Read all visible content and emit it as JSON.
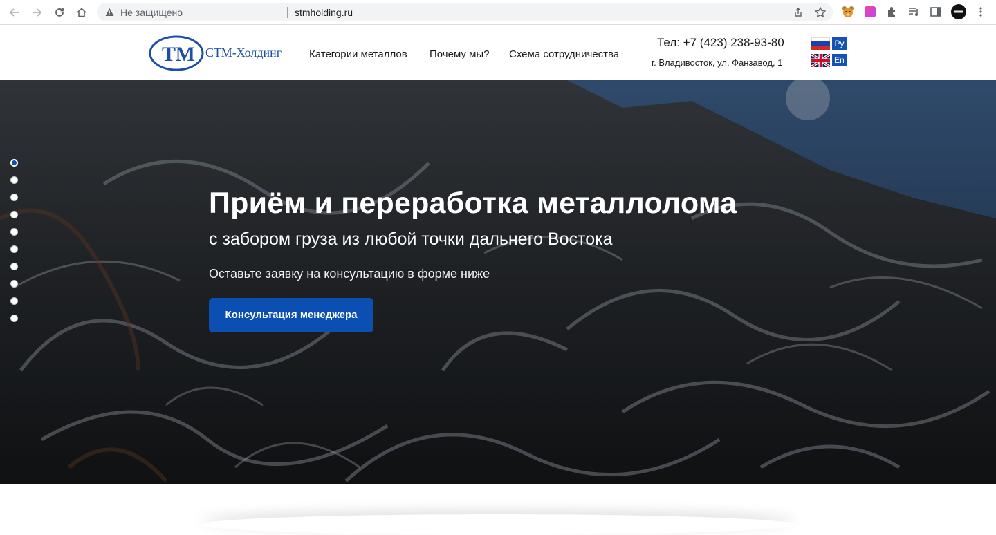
{
  "browser": {
    "security_label": "Не защищено",
    "url": "stmholding.ru"
  },
  "header": {
    "logo_text": "СТМ-Холдинг",
    "logo_mark": "ТМ",
    "menu": [
      {
        "label": "Категории металлов"
      },
      {
        "label": "Почему мы?"
      },
      {
        "label": "Схема сотрудничества"
      }
    ],
    "phone": "Тел: +7 (423) 238-93-80",
    "address": "г. Владивосток, ул. Фанзавод, 1",
    "languages": [
      {
        "code": "Ру",
        "flag": "ru-flag-icon"
      },
      {
        "code": "En",
        "flag": "uk-flag-icon"
      }
    ]
  },
  "hero": {
    "title": "Приём и переработка металлолома",
    "subtitle": "с забором груза из любой точки дальнего Востока",
    "text": "Оставьте заявку на консультацию в форме ниже",
    "cta_label": "Консультация менеджера",
    "slides_count": 10,
    "active_slide": 1
  },
  "colors": {
    "accent": "#0b4fb3",
    "logo": "#1d4fa5"
  }
}
